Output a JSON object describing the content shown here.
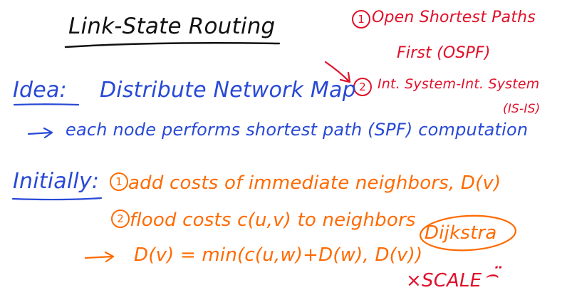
{
  "title": "Link-State Routing",
  "protocols": {
    "one": {
      "number": "1",
      "line1": "Open Shortest Paths",
      "line2": "First (OSPF)"
    },
    "two": {
      "number": "2",
      "line1": "Int. System-Int. System",
      "abbrev": "(IS-IS)"
    }
  },
  "idea": {
    "label": "Idea:",
    "text": "Distribute Network Map",
    "detail": "each node performs shortest path (SPF) computation"
  },
  "initially": {
    "label": "Initially:",
    "step1_number": "1",
    "step1_text": "add costs of immediate neighbors, D(v)",
    "step2_number": "2",
    "step2_text": "flood costs c(u,v) to neighbors",
    "formula": "D(v) = min(c(u,w)+D(w), D(v))"
  },
  "side_notes": {
    "algorithm": "Dijkstra",
    "scale": "×SCALE",
    "face": "⌢̈"
  },
  "colors": {
    "ink_black": "#111111",
    "ink_blue": "#2849d6",
    "ink_red": "#e0102a",
    "ink_orange": "#ff6a00",
    "background": "#ffffff"
  }
}
